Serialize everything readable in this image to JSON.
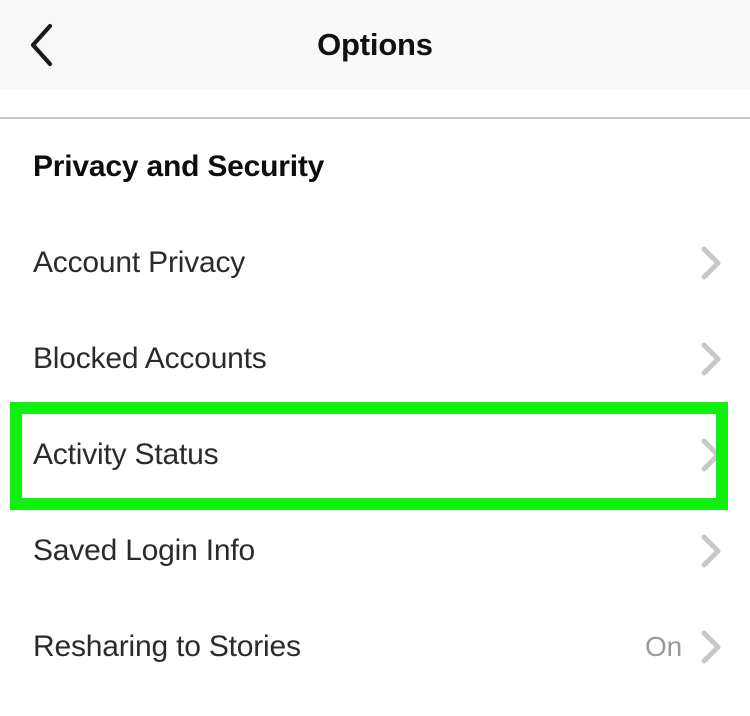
{
  "navbar": {
    "back_icon": "chevron-left-icon",
    "title": "Options"
  },
  "section": {
    "title": "Privacy and Security"
  },
  "rows": [
    {
      "label": "Account Privacy",
      "value": "",
      "chevron": "chevron-right-icon"
    },
    {
      "label": "Blocked Accounts",
      "value": "",
      "chevron": "chevron-right-icon"
    },
    {
      "label": "Activity Status",
      "value": "",
      "chevron": "chevron-right-icon"
    },
    {
      "label": "Saved Login Info",
      "value": "",
      "chevron": "chevron-right-icon"
    },
    {
      "label": "Resharing to Stories",
      "value": "On",
      "chevron": "chevron-right-icon"
    }
  ],
  "highlight": {
    "target_label": "Activity Status",
    "color": "#11ef11"
  },
  "colors": {
    "navbar_background": "#f9f9f9",
    "page_background": "#ffffff",
    "primary_text": "#2b2b2b",
    "secondary_text": "#9a9a9a",
    "chevron": "#c8c8c8",
    "divider": "#c6c6c8",
    "highlight_green": "#11ef11"
  }
}
